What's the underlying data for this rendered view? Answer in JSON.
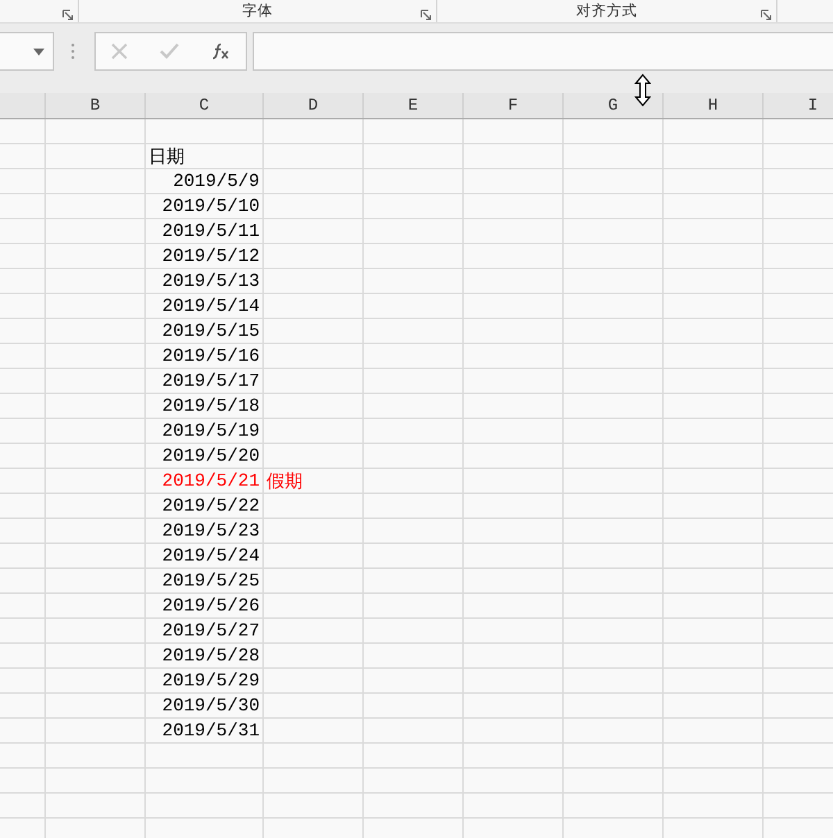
{
  "ribbon": {
    "groups": [
      {
        "label": "字体"
      },
      {
        "label": "对齐方式"
      }
    ]
  },
  "formula_bar": {
    "buttons": [
      {
        "kind": "cancel",
        "disabled": true
      },
      {
        "kind": "enter",
        "disabled": true
      },
      {
        "kind": "function",
        "disabled": false
      }
    ]
  },
  "columns": [
    "B",
    "C",
    "D",
    "E",
    "F",
    "G",
    "H",
    "I"
  ],
  "rows": [
    {
      "kind": "text",
      "C": "日期",
      "color": "#000000"
    },
    {
      "kind": "date",
      "C": "2019/5/9",
      "color": "#000000"
    },
    {
      "kind": "date",
      "C": "2019/5/10",
      "color": "#000000"
    },
    {
      "kind": "date",
      "C": "2019/5/11",
      "color": "#000000"
    },
    {
      "kind": "date",
      "C": "2019/5/12",
      "color": "#000000"
    },
    {
      "kind": "date",
      "C": "2019/5/13",
      "color": "#000000"
    },
    {
      "kind": "date",
      "C": "2019/5/14",
      "color": "#000000"
    },
    {
      "kind": "date",
      "C": "2019/5/15",
      "color": "#000000"
    },
    {
      "kind": "date",
      "C": "2019/5/16",
      "color": "#000000"
    },
    {
      "kind": "date",
      "C": "2019/5/17",
      "color": "#000000"
    },
    {
      "kind": "date",
      "C": "2019/5/18",
      "color": "#000000"
    },
    {
      "kind": "date",
      "C": "2019/5/19",
      "color": "#000000"
    },
    {
      "kind": "date",
      "C": "2019/5/20",
      "color": "#000000"
    },
    {
      "kind": "date",
      "C": "2019/5/21",
      "D": "假期",
      "color": "#ff0000"
    },
    {
      "kind": "date",
      "C": "2019/5/22",
      "color": "#000000"
    },
    {
      "kind": "date",
      "C": "2019/5/23",
      "color": "#000000"
    },
    {
      "kind": "date",
      "C": "2019/5/24",
      "color": "#000000"
    },
    {
      "kind": "date",
      "C": "2019/5/25",
      "color": "#000000"
    },
    {
      "kind": "date",
      "C": "2019/5/26",
      "color": "#000000"
    },
    {
      "kind": "date",
      "C": "2019/5/27",
      "color": "#000000"
    },
    {
      "kind": "date",
      "C": "2019/5/28",
      "color": "#000000"
    },
    {
      "kind": "date",
      "C": "2019/5/29",
      "color": "#000000"
    },
    {
      "kind": "date",
      "C": "2019/5/30",
      "color": "#000000"
    },
    {
      "kind": "date",
      "C": "2019/5/31",
      "color": "#000000"
    }
  ]
}
